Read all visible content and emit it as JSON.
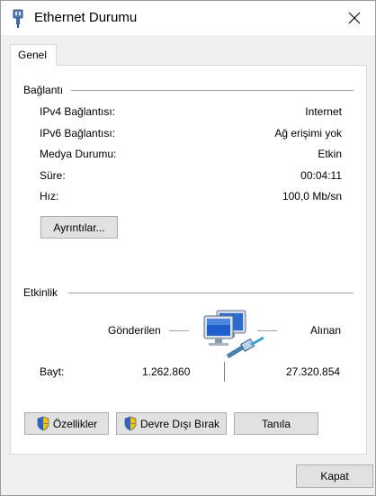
{
  "window": {
    "title": "Ethernet Durumu"
  },
  "tabs": [
    {
      "label": "Genel"
    }
  ],
  "connection": {
    "title": "Bağlantı",
    "rows": [
      {
        "label": "IPv4 Bağlantısı:",
        "value": "Internet"
      },
      {
        "label": "IPv6 Bağlantısı:",
        "value": "Ağ erişimi yok"
      },
      {
        "label": "Medya Durumu:",
        "value": "Etkin"
      },
      {
        "label": "Süre:",
        "value": "00:04:11"
      },
      {
        "label": "Hız:",
        "value": "100,0 Mb/sn"
      }
    ],
    "details_button": "Ayrıntılar..."
  },
  "activity": {
    "title": "Etkinlik",
    "sent_label": "Gönderilen",
    "received_label": "Alınan",
    "bytes_label": "Bayt:",
    "sent_bytes": "1.262.860",
    "received_bytes": "27.320.854"
  },
  "buttons": {
    "properties": "Özellikler",
    "disable": "Devre Dışı Bırak",
    "diagnose": "Tanıla",
    "close": "Kapat"
  },
  "icons": {
    "title": "ethernet-adapter-icon",
    "close": "close-icon",
    "network": "network-computers-icon",
    "shield": "uac-shield-icon"
  }
}
